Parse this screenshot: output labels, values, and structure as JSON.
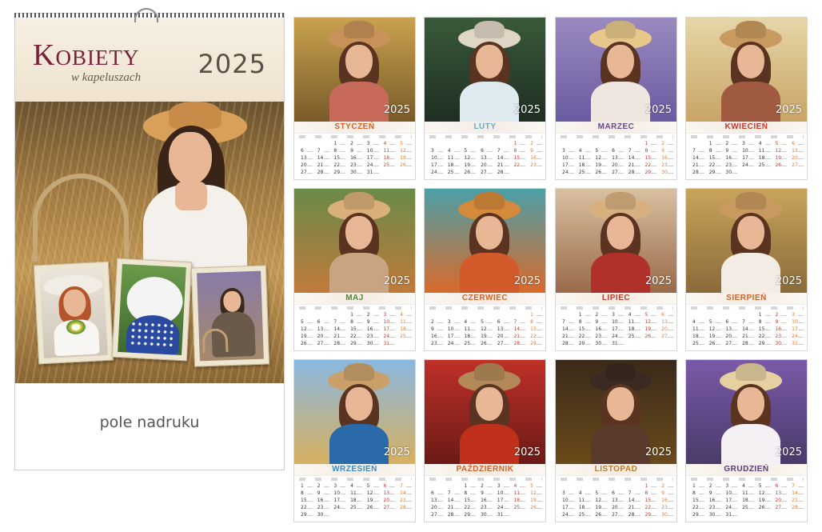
{
  "cover": {
    "title": "Kobiety",
    "subtitle": "w kapeluszach",
    "year": "2025",
    "print_field": "pole nadruku"
  },
  "months": [
    {
      "name": "Styczeń",
      "year": "2025",
      "color": "#d4622a",
      "bg": [
        "#c9a24e",
        "#7a5a2a"
      ],
      "hat": "#c8925a",
      "dress": "#c86a5a"
    },
    {
      "name": "Luty",
      "year": "2025",
      "color": "#6aa7c9",
      "bg": [
        "#3a5a3a",
        "#1e2e22"
      ],
      "hat": "#e0d6c6",
      "dress": "#dfe9f0"
    },
    {
      "name": "Marzec",
      "year": "2025",
      "color": "#6a4a8a",
      "bg": [
        "#9a8ac0",
        "#6a5aa0"
      ],
      "hat": "#e8c88a",
      "dress": "#f0e6e0"
    },
    {
      "name": "Kwiecień",
      "year": "2025",
      "color": "#c0392b",
      "bg": [
        "#e6d6a8",
        "#c9a466"
      ],
      "hat": "#c99a60",
      "dress": "#a05a40"
    },
    {
      "name": "Maj",
      "year": "2025",
      "color": "#4a8a3a",
      "bg": [
        "#6a8a4a",
        "#c07a3a"
      ],
      "hat": "#d9b07a",
      "dress": "#c8a480"
    },
    {
      "name": "Czerwiec",
      "year": "2025",
      "color": "#d4622a",
      "bg": [
        "#4aa0a8",
        "#d96a2a"
      ],
      "hat": "#d48a3a",
      "dress": "#d35a2a"
    },
    {
      "name": "Lipiec",
      "year": "2025",
      "color": "#c0392b",
      "bg": [
        "#d8c0a0",
        "#9a6a4a"
      ],
      "hat": "#d8b080",
      "dress": "#b0302a"
    },
    {
      "name": "Sierpień",
      "year": "2025",
      "color": "#d4622a",
      "bg": [
        "#c9a45a",
        "#8a6a3a"
      ],
      "hat": "#c99a60",
      "dress": "#f2ece4"
    },
    {
      "name": "Wrzesień",
      "year": "2025",
      "color": "#3a8ac0",
      "bg": [
        "#8ab8e0",
        "#d8b060"
      ],
      "hat": "#caa06a",
      "dress": "#2a6aa8"
    },
    {
      "name": "Październik",
      "year": "2025",
      "color": "#d4622a",
      "bg": [
        "#c0302a",
        "#6a1a16"
      ],
      "hat": "#b4895a",
      "dress": "#c0301a"
    },
    {
      "name": "Listopad",
      "year": "2025",
      "color": "#c07a2a",
      "bg": [
        "#3a2a1a",
        "#6a4a1a"
      ],
      "hat": "#3a2a22",
      "dress": "#5a3a2a"
    },
    {
      "name": "Grudzień",
      "year": "2025",
      "color": "#5a3a7a",
      "bg": [
        "#7a5aa8",
        "#4a3a6a"
      ],
      "hat": "#e6cfa0",
      "dress": "#f4f0f4"
    }
  ],
  "calendars": [
    [
      [
        "",
        "",
        "1",
        "2",
        "3",
        "4",
        "5"
      ],
      [
        "6",
        "7",
        "8",
        "9",
        "10",
        "11",
        "12"
      ],
      [
        "13",
        "14",
        "15",
        "16",
        "17",
        "18",
        "19"
      ],
      [
        "20",
        "21",
        "22",
        "23",
        "24",
        "25",
        "26"
      ],
      [
        "27",
        "28",
        "29",
        "30",
        "31",
        "",
        ""
      ]
    ],
    [
      [
        "",
        "",
        "",
        "",
        "",
        "1",
        "2"
      ],
      [
        "3",
        "4",
        "5",
        "6",
        "7",
        "8",
        "9"
      ],
      [
        "10",
        "11",
        "12",
        "13",
        "14",
        "15",
        "16"
      ],
      [
        "17",
        "18",
        "19",
        "20",
        "21",
        "22",
        "23"
      ],
      [
        "24",
        "25",
        "26",
        "27",
        "28",
        "",
        ""
      ]
    ],
    [
      [
        "",
        "",
        "",
        "",
        "",
        "1",
        "2"
      ],
      [
        "3",
        "4",
        "5",
        "6",
        "7",
        "8",
        "9"
      ],
      [
        "10",
        "11",
        "12",
        "13",
        "14",
        "15",
        "16"
      ],
      [
        "17",
        "18",
        "19",
        "20",
        "21",
        "22",
        "23"
      ],
      [
        "24",
        "25",
        "26",
        "27",
        "28",
        "29",
        "30"
      ]
    ],
    [
      [
        "",
        "1",
        "2",
        "3",
        "4",
        "5",
        "6"
      ],
      [
        "7",
        "8",
        "9",
        "10",
        "11",
        "12",
        "13"
      ],
      [
        "14",
        "15",
        "16",
        "17",
        "18",
        "19",
        "20"
      ],
      [
        "21",
        "22",
        "23",
        "24",
        "25",
        "26",
        "27"
      ],
      [
        "28",
        "29",
        "30",
        "",
        "",
        "",
        ""
      ]
    ],
    [
      [
        "",
        "",
        "",
        "1",
        "2",
        "3",
        "4"
      ],
      [
        "5",
        "6",
        "7",
        "8",
        "9",
        "10",
        "11"
      ],
      [
        "12",
        "13",
        "14",
        "15",
        "16",
        "17",
        "18"
      ],
      [
        "19",
        "20",
        "21",
        "22",
        "23",
        "24",
        "25"
      ],
      [
        "26",
        "27",
        "28",
        "29",
        "30",
        "31",
        ""
      ]
    ],
    [
      [
        "",
        "",
        "",
        "",
        "",
        "",
        "1"
      ],
      [
        "2",
        "3",
        "4",
        "5",
        "6",
        "7",
        "8"
      ],
      [
        "9",
        "10",
        "11",
        "12",
        "13",
        "14",
        "15"
      ],
      [
        "16",
        "17",
        "18",
        "19",
        "20",
        "21",
        "22"
      ],
      [
        "23",
        "24",
        "25",
        "26",
        "27",
        "28",
        "29"
      ]
    ],
    [
      [
        "",
        "1",
        "2",
        "3",
        "4",
        "5",
        "6"
      ],
      [
        "7",
        "8",
        "9",
        "10",
        "11",
        "12",
        "13"
      ],
      [
        "14",
        "15",
        "16",
        "17",
        "18",
        "19",
        "20"
      ],
      [
        "21",
        "22",
        "23",
        "24",
        "25",
        "26",
        "27"
      ],
      [
        "28",
        "29",
        "30",
        "31",
        "",
        "",
        ""
      ]
    ],
    [
      [
        "",
        "",
        "",
        "",
        "1",
        "2",
        "3"
      ],
      [
        "4",
        "5",
        "6",
        "7",
        "8",
        "9",
        "10"
      ],
      [
        "11",
        "12",
        "13",
        "14",
        "15",
        "16",
        "17"
      ],
      [
        "18",
        "19",
        "20",
        "21",
        "22",
        "23",
        "24"
      ],
      [
        "25",
        "26",
        "27",
        "28",
        "29",
        "30",
        "31"
      ]
    ],
    [
      [
        "1",
        "2",
        "3",
        "4",
        "5",
        "6",
        "7"
      ],
      [
        "8",
        "9",
        "10",
        "11",
        "12",
        "13",
        "14"
      ],
      [
        "15",
        "16",
        "17",
        "18",
        "19",
        "20",
        "21"
      ],
      [
        "22",
        "23",
        "24",
        "25",
        "26",
        "27",
        "28"
      ],
      [
        "29",
        "30",
        "",
        "",
        "",
        "",
        ""
      ]
    ],
    [
      [
        "",
        "",
        "1",
        "2",
        "3",
        "4",
        "5"
      ],
      [
        "6",
        "7",
        "8",
        "9",
        "10",
        "11",
        "12"
      ],
      [
        "13",
        "14",
        "15",
        "16",
        "17",
        "18",
        "19"
      ],
      [
        "20",
        "21",
        "22",
        "23",
        "24",
        "25",
        "26"
      ],
      [
        "27",
        "28",
        "29",
        "30",
        "31",
        "",
        ""
      ]
    ],
    [
      [
        "",
        "",
        "",
        "",
        "",
        "1",
        "2"
      ],
      [
        "3",
        "4",
        "5",
        "6",
        "7",
        "8",
        "9"
      ],
      [
        "10",
        "11",
        "12",
        "13",
        "14",
        "15",
        "16"
      ],
      [
        "17",
        "18",
        "19",
        "20",
        "21",
        "22",
        "23"
      ],
      [
        "24",
        "25",
        "26",
        "27",
        "28",
        "29",
        "30"
      ]
    ],
    [
      [
        "1",
        "2",
        "3",
        "4",
        "5",
        "6",
        "7"
      ],
      [
        "8",
        "9",
        "10",
        "11",
        "12",
        "13",
        "14"
      ],
      [
        "15",
        "16",
        "17",
        "18",
        "19",
        "20",
        "21"
      ],
      [
        "22",
        "23",
        "24",
        "25",
        "26",
        "27",
        "28"
      ],
      [
        "29",
        "30",
        "31",
        "",
        "",
        "",
        ""
      ]
    ]
  ]
}
